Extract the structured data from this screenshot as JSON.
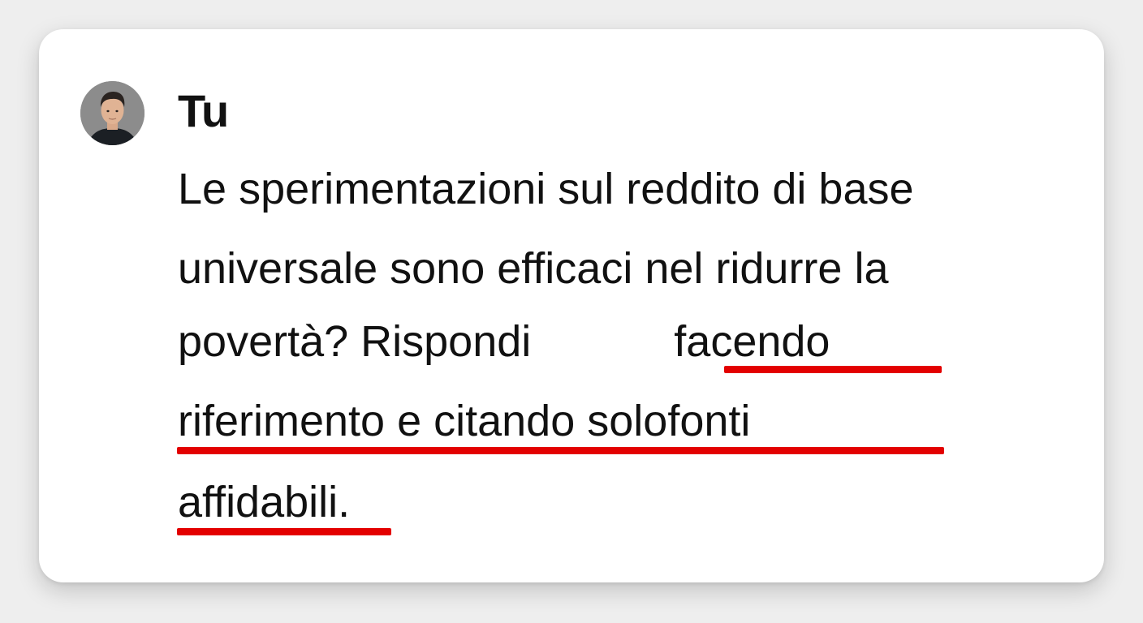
{
  "message": {
    "author": "Tu",
    "avatar_icon": "user-avatar-photo",
    "lines": {
      "line1": "Le sperimentazioni sul reddito di base",
      "line2": "universale sono efficaci nel ridurre la",
      "line3_a": "povertà? Rispondi",
      "line3_b": "facendo",
      "line4_a": "riferimento e citando solo",
      "line4_b": "fonti",
      "line5": "affidabili."
    }
  },
  "colors": {
    "underline": "#e30000",
    "text": "#111111",
    "card": "#ffffff"
  }
}
